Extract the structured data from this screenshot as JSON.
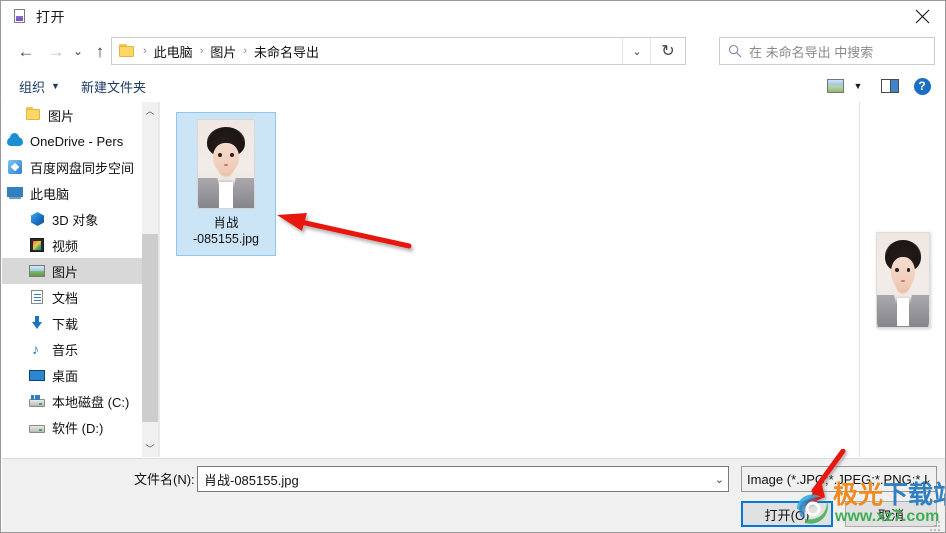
{
  "window": {
    "title": "打开",
    "title_icon": "picture-file-icon",
    "close_label": "✕"
  },
  "address": {
    "back_icon": "arrow-left-icon",
    "forward_icon": "arrow-right-icon",
    "history_icon": "chevron-down-icon",
    "up_icon": "arrow-up-icon",
    "folder_icon": "folder-icon",
    "separator": "›",
    "crumbs": [
      "此电脑",
      "图片",
      "未命名导出"
    ],
    "dropdown_icon": "chevron-down-icon",
    "refresh_icon": "refresh-icon",
    "refresh_glyph": "↻"
  },
  "search": {
    "icon": "search-icon",
    "placeholder": "在 未命名导出 中搜索"
  },
  "toolbar": {
    "organize_label": "组织",
    "organize_caret": "▼",
    "new_folder_label": "新建文件夹",
    "view_icon": "picture-view-icon",
    "view_caret": "▼",
    "preview_pane_icon": "preview-pane-icon",
    "help_icon": "help-icon",
    "help_glyph": "?"
  },
  "sidebar": {
    "items": [
      {
        "label": "图片",
        "icon": "folder-icon",
        "indent": 1,
        "selected": false
      },
      {
        "label": "OneDrive - Pers",
        "icon": "onedrive-cloud-icon",
        "indent": 0,
        "selected": false
      },
      {
        "label": "百度网盘同步空间",
        "icon": "baidu-netdisk-icon",
        "indent": 0,
        "selected": false
      },
      {
        "label": "此电脑",
        "icon": "this-pc-icon",
        "indent": 0,
        "selected": false
      },
      {
        "label": "3D 对象",
        "icon": "3d-objects-icon",
        "indent": 1,
        "selected": false
      },
      {
        "label": "视频",
        "icon": "videos-icon",
        "indent": 1,
        "selected": false
      },
      {
        "label": "图片",
        "icon": "pictures-icon",
        "indent": 1,
        "selected": true
      },
      {
        "label": "文档",
        "icon": "documents-icon",
        "indent": 1,
        "selected": false
      },
      {
        "label": "下载",
        "icon": "downloads-icon",
        "indent": 1,
        "selected": false
      },
      {
        "label": "音乐",
        "icon": "music-icon",
        "indent": 1,
        "selected": false
      },
      {
        "label": "桌面",
        "icon": "desktop-icon",
        "indent": 1,
        "selected": false
      },
      {
        "label": "本地磁盘 (C:)",
        "icon": "system-drive-icon",
        "indent": 1,
        "selected": false
      },
      {
        "label": "软件 (D:)",
        "icon": "drive-icon",
        "indent": 1,
        "selected": false
      }
    ],
    "scroll_up_glyph": "︿",
    "scroll_down_glyph": "﹀"
  },
  "files": [
    {
      "name": "肖战-085155.jpg",
      "name_line1": "肖战",
      "name_line2": "-085155.jpg",
      "selected": true,
      "thumbnail": "portrait-photo"
    }
  ],
  "preview": {
    "thumbnail": "portrait-photo"
  },
  "bottom": {
    "filename_label": "文件名(N):",
    "filename_value": "肖战-085155.jpg",
    "filename_chevron": "⌄",
    "filetype_value": "Image (*.JPG;*.JPEG;*.PNG;*.I",
    "filetype_chevron": "⌄",
    "open_button": "打开(O)",
    "cancel_button": "取消"
  },
  "annotations": {
    "arrow_to_file": "red-arrow-pointing-to-selected-file",
    "arrow_to_open": "red-arrow-pointing-to-open-button"
  },
  "watermark": {
    "text_part1": "极光",
    "text_part2": "下载站",
    "url": "www.xz7.com"
  },
  "colors": {
    "accent": "#0078d7",
    "selection": "#cce5f6",
    "selection_border": "#90c7e8",
    "toolbar_text": "#1b3a66",
    "annotation_red": "#e8130f",
    "watermark_orange": "#f08a1e",
    "watermark_blue": "#2f7fc1",
    "watermark_green": "#3fae55"
  }
}
